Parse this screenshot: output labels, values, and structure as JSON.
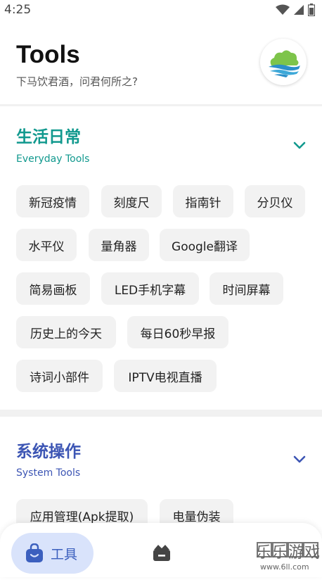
{
  "status": {
    "time": "4:25"
  },
  "header": {
    "title": "Tools",
    "subtitle": "下马饮君酒，问君何所之?"
  },
  "sections": [
    {
      "title": "生活日常",
      "subtitle": "Everyday Tools",
      "color": "#11998e",
      "items": [
        "新冠疫情",
        "刻度尺",
        "指南针",
        "分贝仪",
        "水平仪",
        "量角器",
        "Google翻译",
        "简易画板",
        "LED手机字幕",
        "时间屏幕",
        "历史上的今天",
        "每日60秒早报",
        "诗词小部件",
        "IPTV电视直播"
      ]
    },
    {
      "title": "系统操作",
      "subtitle": "System Tools",
      "color": "#3c55b4",
      "items": [
        "应用管理(Apk提取)",
        "电量伪装"
      ]
    }
  ],
  "nav": {
    "tools_label": "工具"
  },
  "watermark": {
    "text": "乐乐游戏",
    "url": "www.6ll.com"
  }
}
